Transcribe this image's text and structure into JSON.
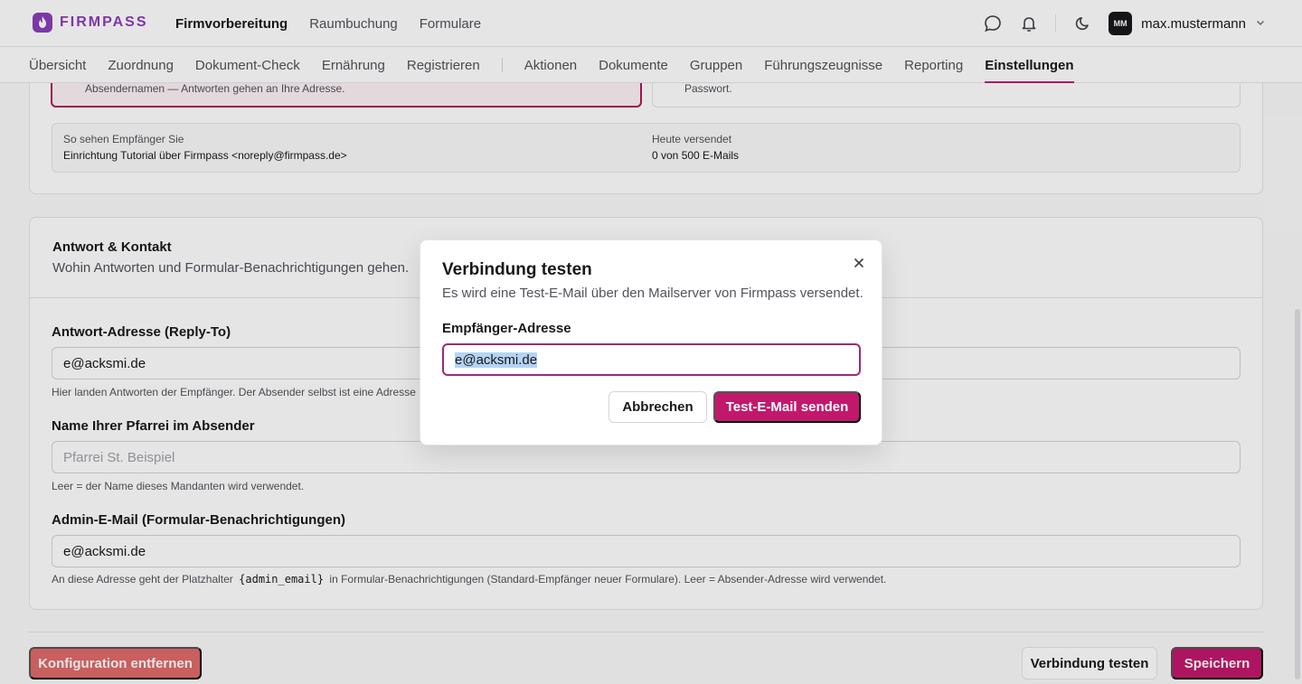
{
  "app": {
    "logo_text": "FIRMPASS",
    "accent": "#c2186b",
    "brand": "#8a3fb8"
  },
  "topnav": {
    "items": [
      "Firmvorbereitung",
      "Raumbuchung",
      "Formulare"
    ],
    "active": 0
  },
  "user": {
    "initials": "MM",
    "name": "max.mustermann"
  },
  "subnav": {
    "items": [
      "Übersicht",
      "Zuordnung",
      "Dokument-Check",
      "Ernährung",
      "Registrieren",
      "Aktionen",
      "Dokumente",
      "Gruppen",
      "Führungszeugnisse",
      "Reporting",
      "Einstellungen"
    ],
    "active": "Einstellungen"
  },
  "sender_section": {
    "sender_hint": "Absendernamen — Antworten gehen an Ihre Adresse.",
    "password_hint": "Passwort.",
    "preview_label": "So sehen Empfänger Sie",
    "preview_value": "Einrichtung Tutorial über Firmpass <noreply@firmpass.de>",
    "sent_label": "Heute versendet",
    "sent_value": "0 von 500 E-Mails"
  },
  "reply_section": {
    "title": "Antwort & Kontakt",
    "subtitle": "Wohin Antworten und Formular-Benachrichtigungen gehen.",
    "reply_to": {
      "label": "Antwort-Adresse (Reply-To)",
      "value": "e@acksmi.de",
      "help": "Hier landen Antworten der Empfänger. Der Absender selbst ist eine Adresse"
    },
    "parish_name": {
      "label": "Name Ihrer Pfarrei im Absender",
      "placeholder": "Pfarrei St. Beispiel",
      "help": "Leer = der Name dieses Mandanten wird verwendet."
    },
    "admin_email": {
      "label": "Admin-E-Mail (Formular-Benachrichtigungen)",
      "value": "e@acksmi.de",
      "help_before": "An diese Adresse geht der Platzhalter",
      "help_code": "{admin_email}",
      "help_after": "in Formular-Benachrichtigungen (Standard-Empfänger neuer Formulare). Leer = Absender-Adresse wird verwendet."
    }
  },
  "footer": {
    "remove_label": "Konfiguration entfernen",
    "test_label": "Verbindung testen",
    "save_label": "Speichern"
  },
  "modal": {
    "title": "Verbindung testen",
    "description": "Es wird eine Test-E-Mail über den Mailserver von Firmpass versendet.",
    "field_label": "Empfänger-Adresse",
    "field_value": "e@acksmi.de",
    "cancel_label": "Abbrechen",
    "send_label": "Test-E-Mail senden"
  }
}
